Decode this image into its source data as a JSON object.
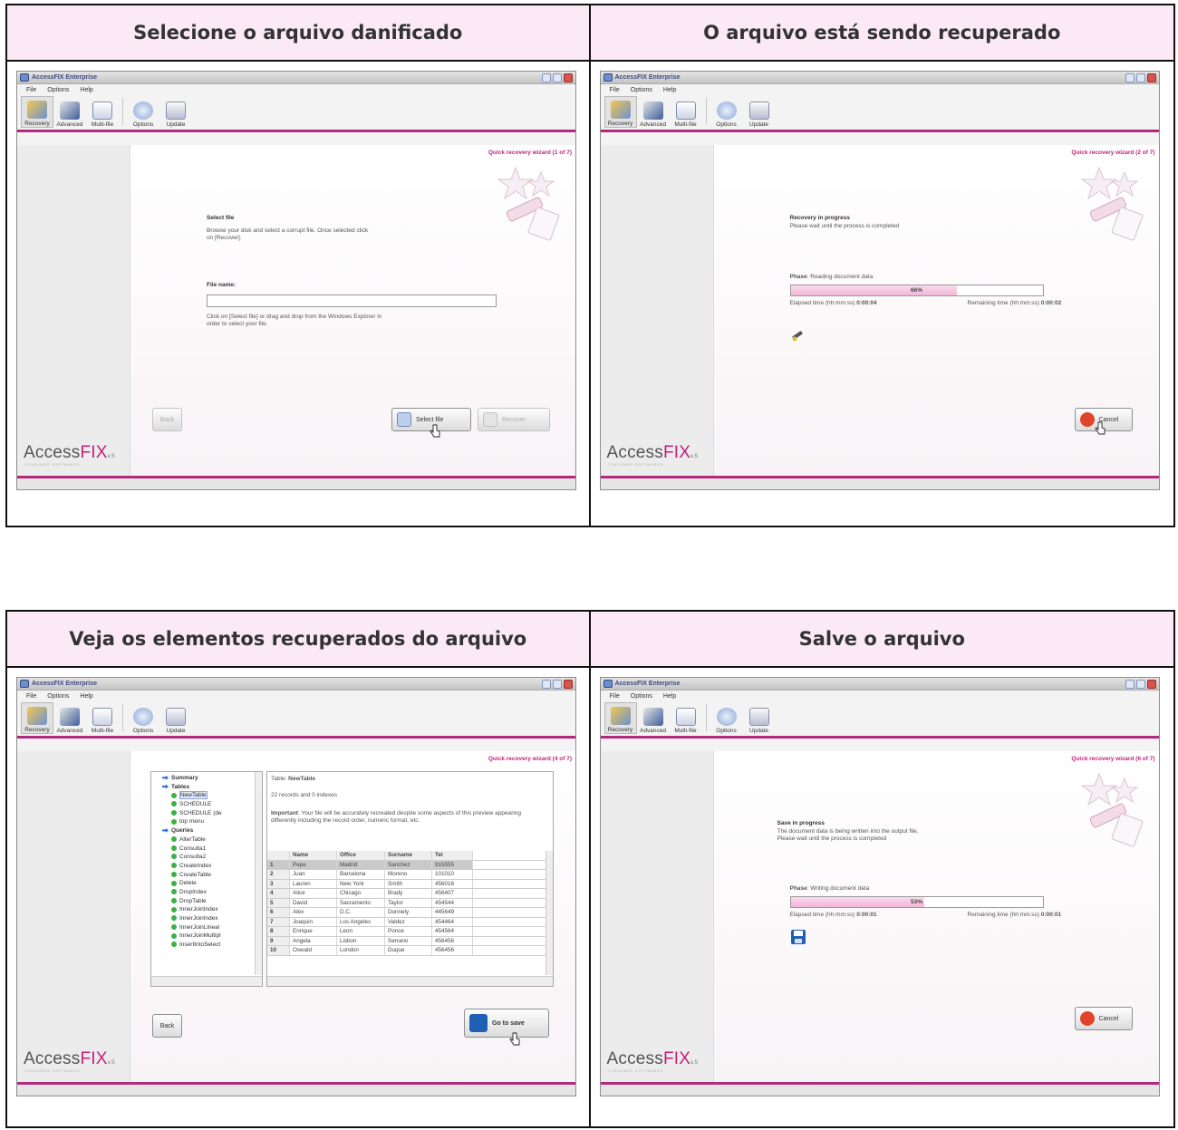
{
  "panels": [
    {
      "caption": "Selecione o arquivo danificado"
    },
    {
      "caption": "O arquivo está sendo recuperado"
    },
    {
      "caption": "Veja os elementos recuperados do arquivo"
    },
    {
      "caption": "Salve o arquivo"
    }
  ],
  "app": {
    "window_title": "AccessFIX Enterprise",
    "menu": [
      "File",
      "Options",
      "Help"
    ],
    "toolbar": [
      "Recovery",
      "Advanced",
      "Multi-file",
      "Options",
      "Update"
    ],
    "logo_main": "Access",
    "logo_accent": "FIX",
    "logo_version": "v.5",
    "logo_sub": "CONSUMER SOFTWARES"
  },
  "step1": {
    "wizard": "Quick recovery wizard (1 of 7)",
    "heading": "Select file",
    "text": "Browse your disk and select a corrupt file. Once selected click on [Recover].",
    "file_label": "File name:",
    "file_value": "",
    "hint": "Click on [Select file] or drag and drop from the Windows Explorer in order to select your file.",
    "back": "Back",
    "select": "Select file",
    "recover": "Recover"
  },
  "step2": {
    "wizard": "Quick recovery wizard (2 of 7)",
    "heading": "Recovery in progress",
    "sub": "Please wait until the process is completed",
    "phase_label": "Phase",
    "phase_value": "Reading document data",
    "percent": "66%",
    "progress": 0.66,
    "elapsed_label": "Elapsed time (hh:mm:ss)",
    "elapsed": "0:00:04",
    "remaining_label": "Remaining time (hh:mm:ss)",
    "remaining": "0:00:02",
    "cancel": "Cancel"
  },
  "step3": {
    "wizard": "Quick recovery wizard (4 of 7)",
    "tree": [
      {
        "label": "Summary",
        "kind": "h",
        "indent": 1
      },
      {
        "label": "Tables",
        "kind": "h",
        "indent": 1
      },
      {
        "label": "NewTable",
        "kind": "sel",
        "indent": 2
      },
      {
        "label": "SCHEDULE",
        "kind": "n",
        "indent": 2
      },
      {
        "label": "SCHEDULE (de",
        "kind": "n",
        "indent": 2
      },
      {
        "label": "top menu",
        "kind": "n",
        "indent": 2
      },
      {
        "label": "Queries",
        "kind": "h",
        "indent": 1
      },
      {
        "label": "AlterTable",
        "kind": "n",
        "indent": 2
      },
      {
        "label": "Consulta1",
        "kind": "n",
        "indent": 2
      },
      {
        "label": "Consulta2",
        "kind": "n",
        "indent": 2
      },
      {
        "label": "CreateIndex",
        "kind": "n",
        "indent": 2
      },
      {
        "label": "CreateTable",
        "kind": "n",
        "indent": 2
      },
      {
        "label": "Delete",
        "kind": "n",
        "indent": 2
      },
      {
        "label": "DropIndex",
        "kind": "n",
        "indent": 2
      },
      {
        "label": "DropTable",
        "kind": "n",
        "indent": 2
      },
      {
        "label": "InnerJoinIndex",
        "kind": "n",
        "indent": 2
      },
      {
        "label": "InnerJoinIndex",
        "kind": "n",
        "indent": 2
      },
      {
        "label": "InnerJoinLineal",
        "kind": "n",
        "indent": 2
      },
      {
        "label": "InnerJoinMultipl",
        "kind": "n",
        "indent": 2
      },
      {
        "label": "InsertIntoSelect",
        "kind": "n",
        "indent": 2
      }
    ],
    "table_prefix": "Table:",
    "table_name": "NewTable",
    "records": "22 records and 0 indexes",
    "important_label": "Important",
    "important_text": ": Your file will be accurately recreated despite some aspects of this preview appearing differently including the record order, numeric format, etc.",
    "columns": [
      "",
      "Name",
      "Office",
      "Surname",
      "Tel"
    ],
    "rows": [
      [
        "1",
        "Pepe",
        "Madrid",
        "Sanchez",
        "915555"
      ],
      [
        "2",
        "Juan",
        "Barcelona",
        "Moreno",
        "101010"
      ],
      [
        "3",
        "Lauren",
        "New York",
        "Smith",
        "456016"
      ],
      [
        "4",
        "Alice",
        "Chicago",
        "Brady",
        "456407"
      ],
      [
        "5",
        "David",
        "Sacramento",
        "Taylor",
        "454544"
      ],
      [
        "6",
        "Alex",
        "D.C.",
        "Donnely",
        "445649"
      ],
      [
        "7",
        "Joaquin",
        "Los Angeles",
        "Valdez",
        "454464"
      ],
      [
        "8",
        "Enrique",
        "Leon",
        "Ponce",
        "454564"
      ],
      [
        "9",
        "Angela",
        "Lisbon",
        "Serrano",
        "456456"
      ],
      [
        "10",
        "Oswald",
        "London",
        "Duque",
        "456456"
      ]
    ],
    "back": "Back",
    "save": "Go to save"
  },
  "step4": {
    "wizard": "Quick recovery wizard (6 of 7)",
    "heading": "Save in progress",
    "sub1": "The document data is being written into the output file.",
    "sub2": "Please wait until the process is completed",
    "phase_label": "Phase",
    "phase_value": "Writing document data",
    "percent": "53%",
    "progress": 0.53,
    "elapsed_label": "Elapsed time (hh:mm:ss)",
    "elapsed": "0:00:01",
    "remaining_label": "Remaining time (hh:mm:ss)",
    "remaining": "0:00:01",
    "cancel": "Cancel"
  }
}
